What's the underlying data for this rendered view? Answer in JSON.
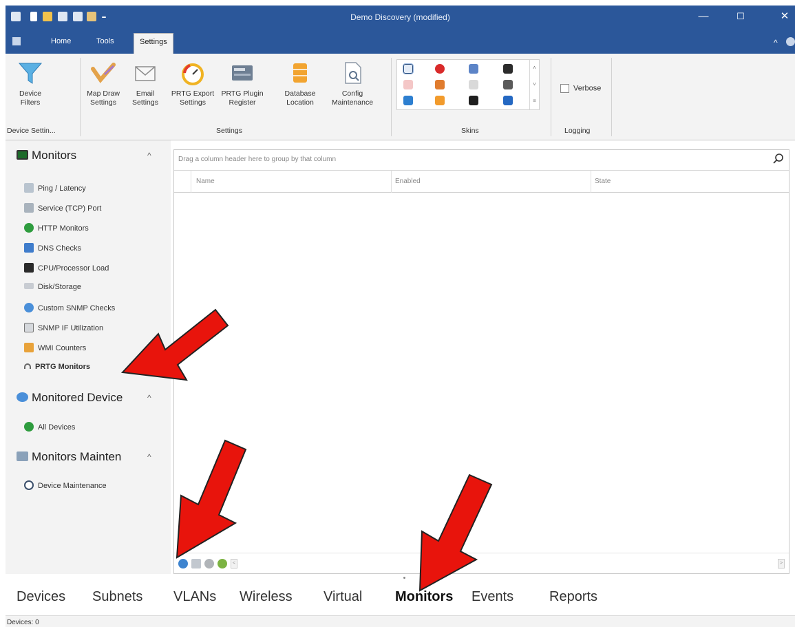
{
  "window": {
    "title": "Demo Discovery (modified)",
    "controls": {
      "minimize": "—",
      "maximize": "☐",
      "close": "✕"
    },
    "ribbon_collapse": "^"
  },
  "ribbon": {
    "tabs": [
      {
        "label": "Home",
        "active": false
      },
      {
        "label": "Tools",
        "active": false
      },
      {
        "label": "Settings",
        "active": true
      }
    ],
    "groups": [
      {
        "label": "Device Settin..."
      },
      {
        "label": "Settings"
      },
      {
        "label": "Skins"
      },
      {
        "label": "Logging"
      }
    ],
    "buttons": [
      {
        "label1": "Device",
        "label2": "Filters",
        "icon": "funnel-icon"
      },
      {
        "label1": "Map Draw",
        "label2": "Settings",
        "icon": "pencil-icon"
      },
      {
        "label1": "Email",
        "label2": "Settings",
        "icon": "envelope-icon"
      },
      {
        "label1": "PRTG Export",
        "label2": "Settings",
        "icon": "gauge-icon"
      },
      {
        "label1": "PRTG Plugin",
        "label2": "Register",
        "icon": "server-icon"
      },
      {
        "label1": "Database",
        "label2": "Location",
        "icon": "database-icon"
      },
      {
        "label1": "Config",
        "label2": "Maintenance",
        "icon": "document-wrench-icon"
      }
    ],
    "verbose_label": "Verbose",
    "verbose_checked": false
  },
  "sidebar": {
    "sections": [
      {
        "title": "Monitors",
        "items": [
          {
            "label": "Ping / Latency"
          },
          {
            "label": "Service (TCP) Port"
          },
          {
            "label": "HTTP Monitors"
          },
          {
            "label": "DNS Checks"
          },
          {
            "label": "CPU/Processor Load"
          },
          {
            "label": "Disk/Storage"
          },
          {
            "label": "Custom SNMP Checks"
          },
          {
            "label": "SNMP IF Utilization"
          },
          {
            "label": "WMI Counters"
          },
          {
            "label": "PRTG Monitors",
            "selected": true
          }
        ]
      },
      {
        "title": "Monitored Device",
        "items": [
          {
            "label": "All Devices"
          }
        ]
      },
      {
        "title": "Monitors Mainten",
        "items": [
          {
            "label": "Device Maintenance"
          }
        ]
      }
    ]
  },
  "grid": {
    "group_hint": "Drag a column header here to group by that column",
    "columns": [
      "Name",
      "Enabled",
      "State"
    ],
    "rows": []
  },
  "bottom_tabs": [
    {
      "label": "Devices",
      "active": false
    },
    {
      "label": "Subnets",
      "active": false
    },
    {
      "label": "VLANs",
      "active": false
    },
    {
      "label": "Wireless",
      "active": false
    },
    {
      "label": "Virtual",
      "active": false
    },
    {
      "label": "Monitors",
      "active": true
    },
    {
      "label": "Events",
      "active": false
    },
    {
      "label": "Reports",
      "active": false
    }
  ],
  "status": {
    "text": "Devices: 0"
  },
  "colors": {
    "titlebar": "#2b579a",
    "ribbon_bg": "#f3f3f3",
    "annotation_arrow": "#e8140c"
  }
}
